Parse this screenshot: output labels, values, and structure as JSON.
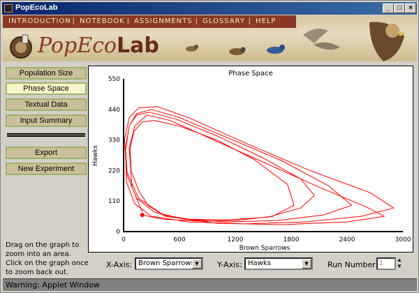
{
  "window": {
    "title": "PopEcoLab",
    "icons": {
      "app": "app-icon",
      "minimize": "minimize-icon",
      "maximize": "maximize-icon",
      "close": "close-icon"
    }
  },
  "banner": {
    "menu": [
      "INTRODUCTION",
      "NOTEBOOK",
      "ASSIGNMENTS",
      "GLOSSARY",
      "HELP"
    ],
    "logo_part1": "PopEco",
    "logo_part2": "Lab"
  },
  "nav": {
    "items": [
      "Population Size",
      "Phase Space",
      "Textual Data",
      "Input Summary"
    ],
    "active": "Phase Space",
    "actions": [
      "Export",
      "New Experiment"
    ]
  },
  "help_text": "Drag on the graph to zoom into an area. Click on the graph once to zoom back out.",
  "chart_data": {
    "type": "line",
    "title": "Phase Space",
    "xlabel": "Brown Sparrows",
    "ylabel": "Hawks",
    "xlim": [
      0,
      3000
    ],
    "ylim": [
      0,
      550
    ],
    "xticks": [
      "0",
      "600",
      "1200",
      "1800",
      "2400",
      "3000"
    ],
    "yticks": [
      "0",
      "110",
      "220",
      "330",
      "440",
      "550"
    ],
    "color": "#ff0000",
    "series": [
      {
        "x": [
          200,
          420,
          800,
          1200,
          1600,
          1830,
          1760,
          1400,
          1000,
          600,
          330,
          200,
          110,
          70,
          80,
          160,
          260,
          420,
          700,
          1100,
          1550,
          1900,
          2050,
          1900,
          1500,
          1000,
          560,
          280,
          140,
          60,
          20,
          40,
          140,
          330,
          650,
          1100,
          1650,
          2150,
          2450,
          2200,
          1700,
          1100,
          600,
          300,
          140,
          60,
          20,
          30,
          120,
          300,
          700,
          1300,
          1950,
          2550,
          2900,
          2650,
          2000,
          1300,
          700,
          360,
          160,
          60,
          10,
          30,
          160,
          450,
          1000,
          1700,
          2400,
          2800,
          2600,
          2100,
          1500,
          900,
          500,
          250,
          120,
          60,
          90,
          200
        ],
        "y": [
          60,
          45,
          38,
          40,
          55,
          95,
          170,
          260,
          330,
          380,
          400,
          395,
          360,
          300,
          220,
          150,
          95,
          60,
          45,
          42,
          52,
          85,
          130,
          190,
          265,
          345,
          405,
          430,
          420,
          380,
          300,
          200,
          120,
          70,
          45,
          35,
          40,
          60,
          95,
          165,
          255,
          340,
          410,
          440,
          425,
          380,
          290,
          180,
          100,
          55,
          35,
          28,
          35,
          55,
          85,
          140,
          220,
          320,
          410,
          450,
          445,
          410,
          330,
          220,
          120,
          55,
          30,
          25,
          35,
          55,
          90,
          160,
          250,
          340,
          400,
          420,
          380,
          300,
          160,
          70
        ]
      }
    ],
    "start_point": {
      "x": 200,
      "y": 60
    }
  },
  "controls": {
    "x_axis_label": "X-Axis:",
    "x_axis_value": "Brown Sparrows",
    "y_axis_label": "Y-Axis:",
    "y_axis_value": "Hawks",
    "run_number_label": "Run Number:",
    "run_number_value": "1"
  },
  "status": "Warning: Applet Window"
}
